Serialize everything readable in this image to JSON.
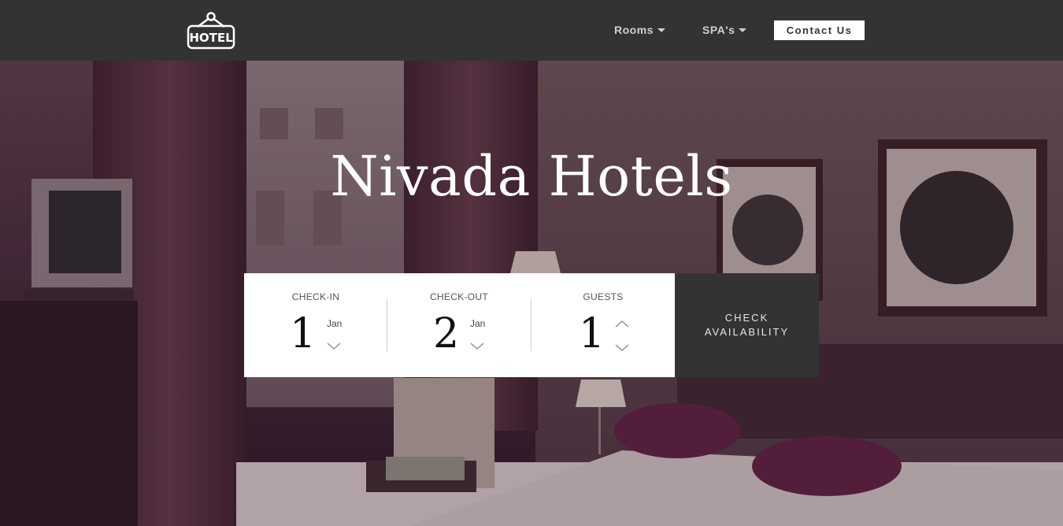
{
  "header": {
    "logo_text": "HOTEL",
    "nav": [
      {
        "label": "Rooms",
        "has_dropdown": true
      },
      {
        "label": "SPA's",
        "has_dropdown": true
      }
    ],
    "contact_label": "Contact Us"
  },
  "hero": {
    "title": "Nivada Hotels"
  },
  "booking": {
    "checkin": {
      "label": "CHECK-IN",
      "day": "1",
      "month": "Jan"
    },
    "checkout": {
      "label": "CHECK-OUT",
      "day": "2",
      "month": "Jan"
    },
    "guests": {
      "label": "GUESTS",
      "count": "1"
    },
    "check_button": {
      "line1": "CHECK",
      "line2": "AVAILABILITY"
    }
  },
  "colors": {
    "navbar_bg": "#333333",
    "panel_bg": "#ffffff",
    "button_bg": "#333333",
    "hero_tint": "#3a2333"
  },
  "icons": [
    "hotel-sign-icon",
    "caret-down-icon",
    "chevron-up-icon",
    "chevron-down-icon"
  ]
}
